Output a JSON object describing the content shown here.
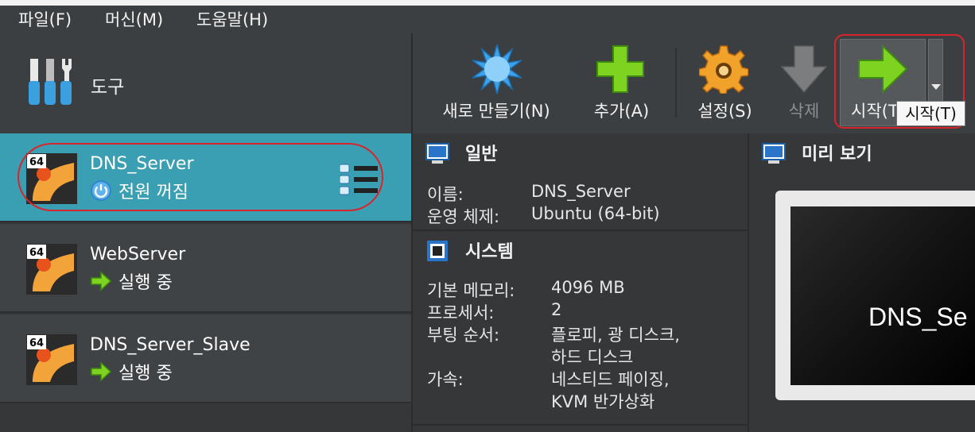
{
  "menubar": {
    "items": [
      "파일(F)",
      "머신(M)",
      "도움말(H)"
    ]
  },
  "tools": {
    "label": "도구",
    "icon": "tools-icon"
  },
  "toolbar": {
    "new_label": "새로 만들기(N)",
    "add_label": "추가(A)",
    "settings_label": "설정(S)",
    "delete_label": "삭제",
    "start_label": "시작(T)",
    "tooltip": "시작(T)"
  },
  "vm_list": [
    {
      "name": "DNS_Server",
      "state": "전원 꺼짐",
      "state_icon": "power-off-icon",
      "os_badge": "64",
      "selected": true
    },
    {
      "name": "WebServer",
      "state": "실행 중",
      "state_icon": "running-arrow-icon",
      "os_badge": "64",
      "selected": false
    },
    {
      "name": "DNS_Server_Slave",
      "state": "실행 중",
      "state_icon": "running-arrow-icon",
      "os_badge": "64",
      "selected": false
    }
  ],
  "details": {
    "general": {
      "title": "일반",
      "name_label": "이름:",
      "name_value": "DNS_Server",
      "os_label": "운영 체제:",
      "os_value": "Ubuntu (64-bit)"
    },
    "system": {
      "title": "시스템",
      "memory_label": "기본 메모리:",
      "memory_value": "4096 MB",
      "cpu_label": "프로세서:",
      "cpu_value": "2",
      "boot_label": "부팅 순서:",
      "boot_value_1": "플로피, 광 디스크,",
      "boot_value_2": "하드 디스크",
      "accel_label": "가속:",
      "accel_value_1": "네스티드 페이징,",
      "accel_value_2": "KVM 반가상화"
    }
  },
  "preview": {
    "title": "미리 보기",
    "screen_text": "DNS_Se"
  },
  "colors": {
    "selected_row": "#3b9fb3",
    "highlight_outline": "#d8242a",
    "background": "#3c3f41"
  }
}
